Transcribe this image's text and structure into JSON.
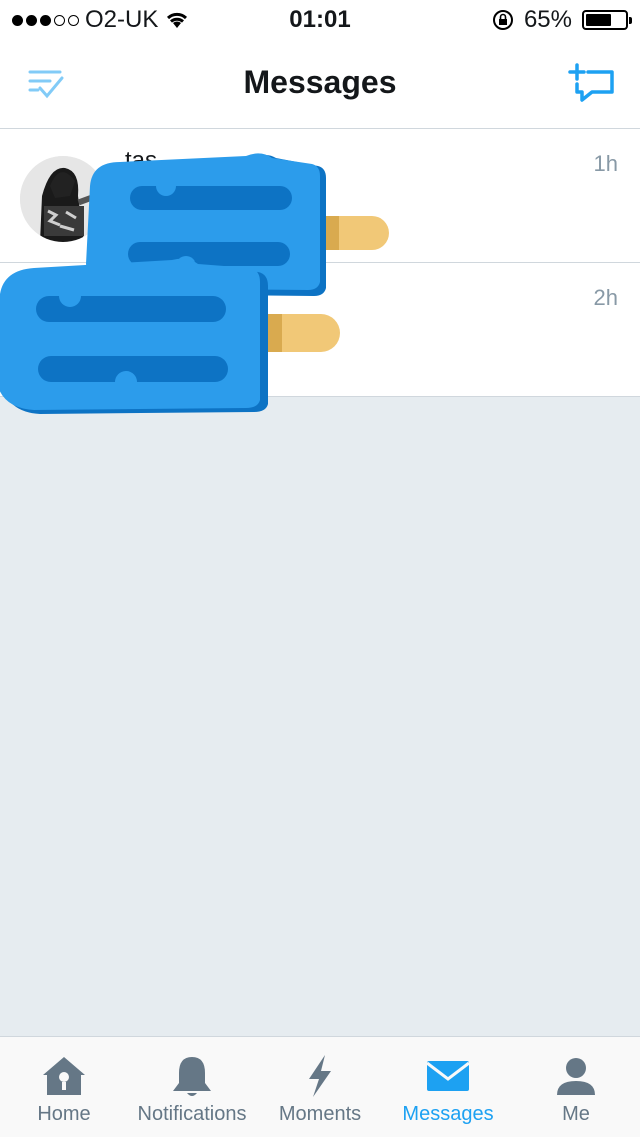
{
  "status_bar": {
    "carrier": "O2-UK",
    "time": "01:01",
    "battery_percent": "65%",
    "battery_level": 0.65
  },
  "nav": {
    "title": "Messages",
    "left_icon": "filter-read-icon",
    "right_icon": "new-message-icon"
  },
  "conversations": [
    {
      "name": "tas",
      "time": "1h"
    },
    {
      "name": "",
      "time": "2h"
    }
  ],
  "tabs": [
    {
      "label": "Home",
      "icon": "home-icon",
      "active": false
    },
    {
      "label": "Notifications",
      "icon": "bell-icon",
      "active": false
    },
    {
      "label": "Moments",
      "icon": "lightning-icon",
      "active": false
    },
    {
      "label": "Messages",
      "icon": "envelope-icon",
      "active": true
    },
    {
      "label": "Me",
      "icon": "person-icon",
      "active": false
    }
  ],
  "colors": {
    "accent": "#1DA1F2",
    "inactive": "#657786",
    "sticker_blue": "#2C9CEB",
    "sticker_stick": "#F1C877"
  }
}
